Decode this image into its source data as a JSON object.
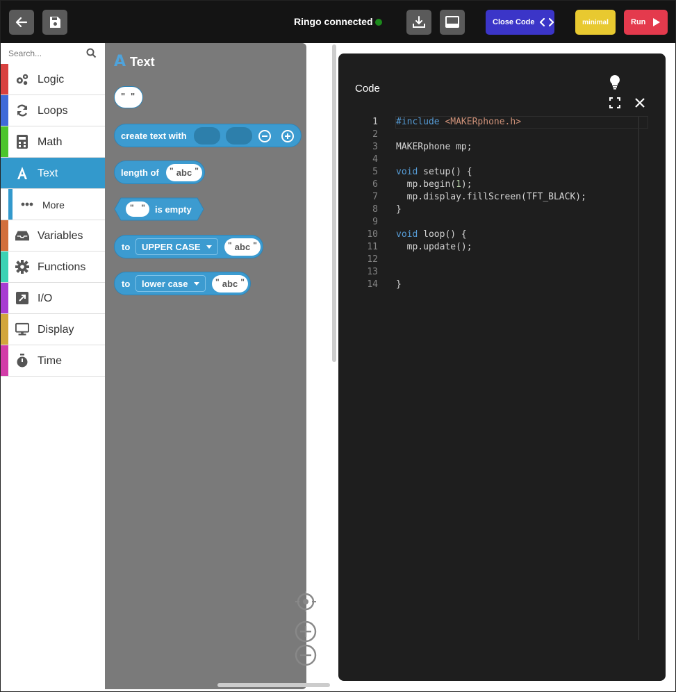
{
  "topbar": {
    "connection_status": "Ringo connected",
    "close_code_label": "Close Code",
    "minimal_label": "minimal",
    "run_label": "Run",
    "status_color": "#1c8a1c"
  },
  "sidebar": {
    "search_placeholder": "Search...",
    "categories": [
      {
        "label": "Logic",
        "icon": "gears-icon",
        "color": "#d8413f"
      },
      {
        "label": "Loops",
        "icon": "refresh-icon",
        "color": "#3f6ad8"
      },
      {
        "label": "Math",
        "icon": "calculator-icon",
        "color": "#4cc52c"
      },
      {
        "label": "Text",
        "icon": "font-icon",
        "color": "#3399cc"
      },
      {
        "label": "More",
        "icon": "ellipsis-icon",
        "color": "#3399cc"
      },
      {
        "label": "Variables",
        "icon": "inbox-icon",
        "color": "#d26f3c"
      },
      {
        "label": "Functions",
        "icon": "gear-icon",
        "color": "#3cd2b4"
      },
      {
        "label": "I/O",
        "icon": "external-icon",
        "color": "#a83cd2"
      },
      {
        "label": "Display",
        "icon": "monitor-icon",
        "color": "#d2a63c"
      },
      {
        "label": "Time",
        "icon": "stopwatch-icon",
        "color": "#d23ca8"
      }
    ]
  },
  "flyout": {
    "title": "Text",
    "create_text_label": "create text with",
    "length_of_label": "length of",
    "is_empty_label": "is empty",
    "to_label": "to",
    "upper_case_label": "UPPER CASE",
    "lower_case_label": "lower case",
    "abc": "abc",
    "quote": "\""
  },
  "code_panel": {
    "title": "Code",
    "lines": [
      {
        "n": "1"
      },
      {
        "n": "2"
      },
      {
        "n": "3"
      },
      {
        "n": "4"
      },
      {
        "n": "5"
      },
      {
        "n": "6"
      },
      {
        "n": "7"
      },
      {
        "n": "8"
      },
      {
        "n": "9"
      },
      {
        "n": "10"
      },
      {
        "n": "11"
      },
      {
        "n": "12"
      },
      {
        "n": "13"
      },
      {
        "n": "14"
      }
    ],
    "code": {
      "l1_kw": "#include",
      "l1_str": "<MAKERphone.h>",
      "l3": "MAKERphone mp;",
      "l5_kw": "void",
      "l5_rest": " setup() {",
      "l6_a": "  mp.begin(",
      "l6_num": "1",
      "l6_b": ");",
      "l7": "  mp.display.fillScreen(TFT_BLACK);",
      "l8": "}",
      "l10_kw": "void",
      "l10_rest": " loop() {",
      "l11": "  mp.update();",
      "l14": "}"
    }
  }
}
